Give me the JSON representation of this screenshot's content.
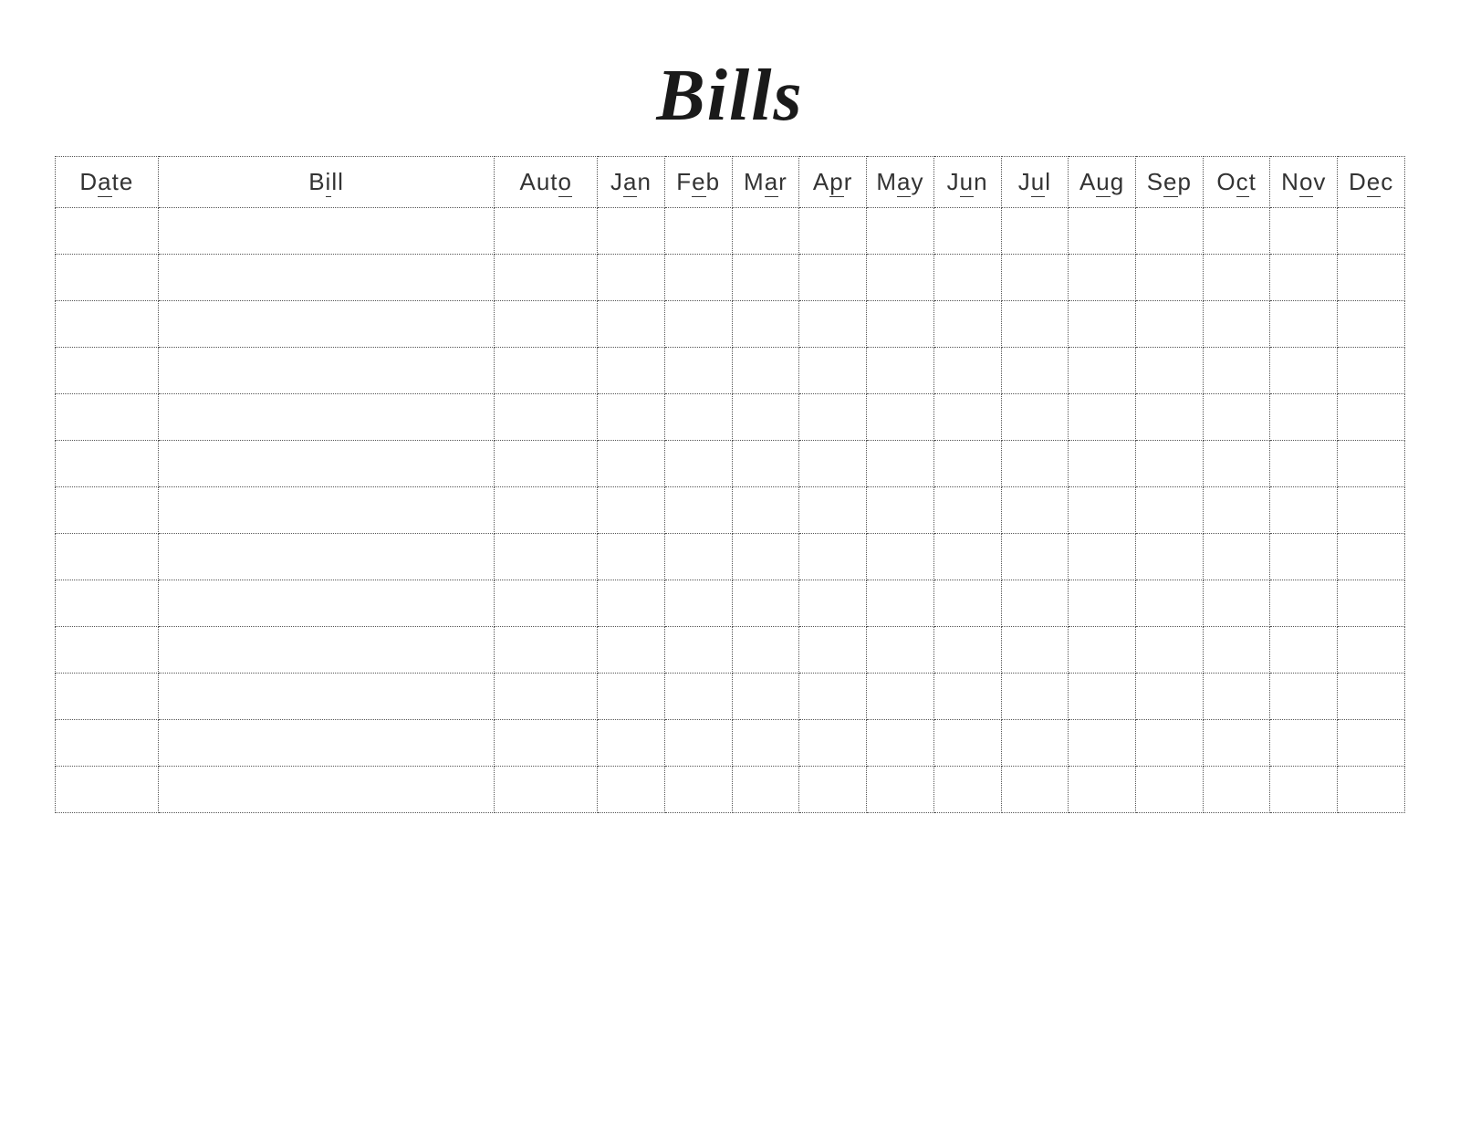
{
  "title": "Bills",
  "columns": {
    "date": {
      "pre": "D",
      "u": "a",
      "post": "te"
    },
    "bill": {
      "pre": "B",
      "u": "i",
      "post": "ll"
    },
    "auto": {
      "pre": "Aut",
      "u": "o",
      "post": ""
    },
    "months": [
      {
        "pre": "J",
        "u": "a",
        "post": "n"
      },
      {
        "pre": "F",
        "u": "e",
        "post": "b"
      },
      {
        "pre": "M",
        "u": "a",
        "post": "r"
      },
      {
        "pre": "A",
        "u": "p",
        "post": "r"
      },
      {
        "pre": "M",
        "u": "a",
        "post": "y"
      },
      {
        "pre": "J",
        "u": "u",
        "post": "n"
      },
      {
        "pre": "J",
        "u": "u",
        "post": "l"
      },
      {
        "pre": "A",
        "u": "u",
        "post": "g"
      },
      {
        "pre": "S",
        "u": "e",
        "post": "p"
      },
      {
        "pre": "O",
        "u": "c",
        "post": "t"
      },
      {
        "pre": "N",
        "u": "o",
        "post": "v"
      },
      {
        "pre": "D",
        "u": "e",
        "post": "c"
      }
    ]
  },
  "rows": 13
}
